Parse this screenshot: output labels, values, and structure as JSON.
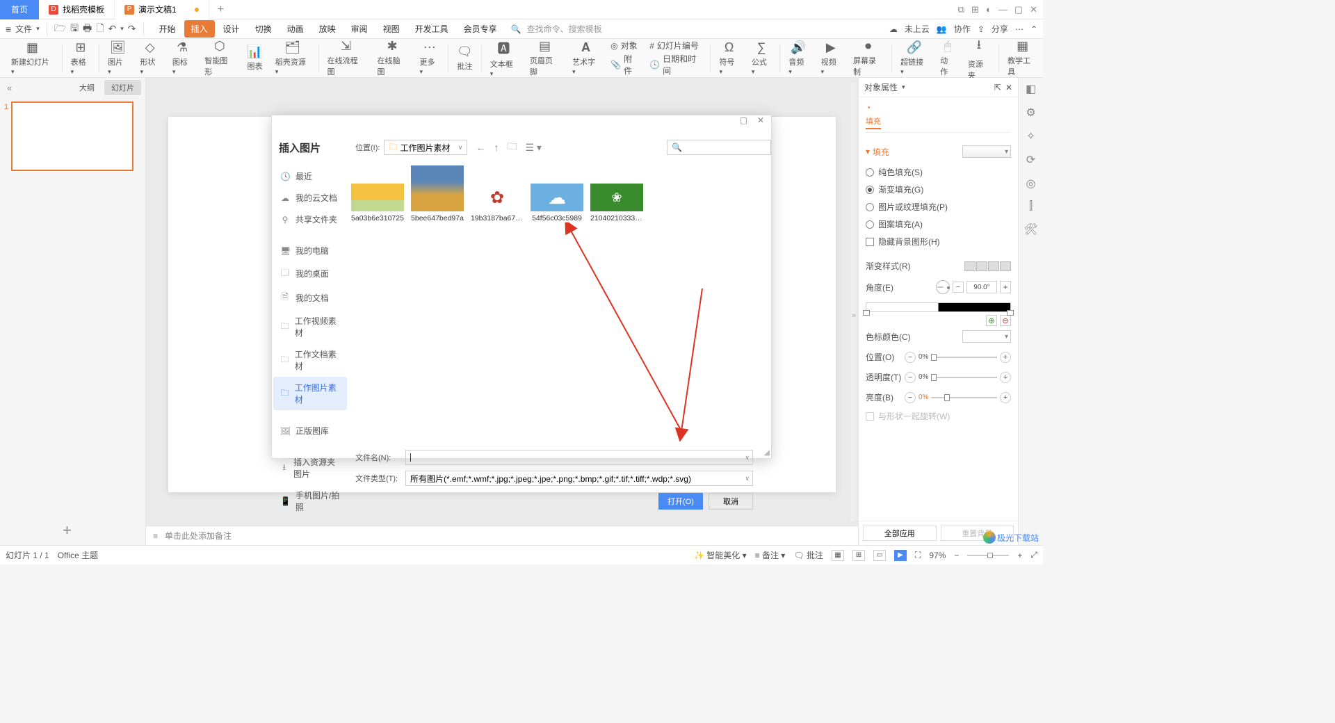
{
  "titlebar": {
    "home": "首页",
    "tab1": "找稻壳模板",
    "tab2": "演示文稿1"
  },
  "menubar": {
    "file": "文件",
    "tabs": [
      "开始",
      "插入",
      "设计",
      "切换",
      "动画",
      "放映",
      "审阅",
      "视图",
      "开发工具",
      "会员专享"
    ],
    "search_placeholder": "查找命令、搜索模板",
    "right": {
      "cloud": "未上云",
      "collab": "协作",
      "share": "分享"
    }
  },
  "ribbon": {
    "items": [
      "新建幻灯片",
      "表格",
      "图片",
      "形状",
      "图标",
      "智能图形",
      "图表",
      "稻壳资源",
      "在线流程图",
      "在线脑图",
      "更多",
      "批注",
      "文本框",
      "页眉页脚",
      "艺术字"
    ],
    "mini": {
      "object": "对象",
      "attach": "附件",
      "slidenum": "幻灯片编号",
      "datetime": "日期和时间"
    },
    "items2": [
      "符号",
      "公式",
      "音频",
      "视频",
      "屏幕录制",
      "超链接",
      "动作",
      "资源夹",
      "教学工具"
    ]
  },
  "slidepanel": {
    "outline": "大纲",
    "slides": "幻灯片",
    "num": "1"
  },
  "notes": "单击此处添加备注",
  "rightpanel": {
    "title": "对象属性",
    "fill_label": "填充",
    "fill_sec": "填充",
    "solid": "纯色填充(S)",
    "grad": "渐变填充(G)",
    "pictex": "图片或纹理填充(P)",
    "pattern": "图案填充(A)",
    "hidebg": "隐藏背景图形(H)",
    "gradstyle": "渐变样式(R)",
    "angle": "角度(E)",
    "angle_val": "90.0°",
    "stopcolor": "色标颜色(C)",
    "position": "位置(O)",
    "pos_val": "0%",
    "trans": "透明度(T)",
    "trans_val": "0%",
    "bright": "亮度(B)",
    "bright_val": "0%",
    "rotate": "与形状一起旋转(W)",
    "btn_all": "全部应用",
    "btn_reset": "重置背景"
  },
  "status": {
    "slide": "幻灯片 1 / 1",
    "theme": "Office 主题",
    "beautify": "智能美化",
    "notes": "备注",
    "notes2": "批注",
    "zoom": "97%"
  },
  "dialog": {
    "title": "插入图片",
    "loc_label": "位置(I):",
    "loc_val": "工作图片素材",
    "sidebar": {
      "recent": "最近",
      "cloud": "我的云文档",
      "share": "共享文件夹",
      "pc": "我的电脑",
      "desktop": "我的桌面",
      "docs": "我的文档",
      "video": "工作视频素材",
      "textdoc": "工作文档素材",
      "imgdoc": "工作图片素材",
      "gallery": "正版图库",
      "resfolder": "插入资源夹图片",
      "phone": "手机图片/拍照"
    },
    "files": [
      {
        "name": "5a03b6e310725"
      },
      {
        "name": "5bee647bed97a"
      },
      {
        "name": "19b3187ba671..."
      },
      {
        "name": "54f56c03c5989"
      },
      {
        "name": "210402103339-..."
      }
    ],
    "fname_label": "文件名(N):",
    "fname_val": "",
    "ftype_label": "文件类型(T):",
    "ftype_val": "所有图片(*.emf;*.wmf;*.jpg;*.jpeg;*.jpe;*.png;*.bmp;*.gif;*.tif;*.tiff;*.wdp;*.svg)",
    "open": "打开(O)",
    "cancel": "取消"
  },
  "watermark": "极光下载站"
}
